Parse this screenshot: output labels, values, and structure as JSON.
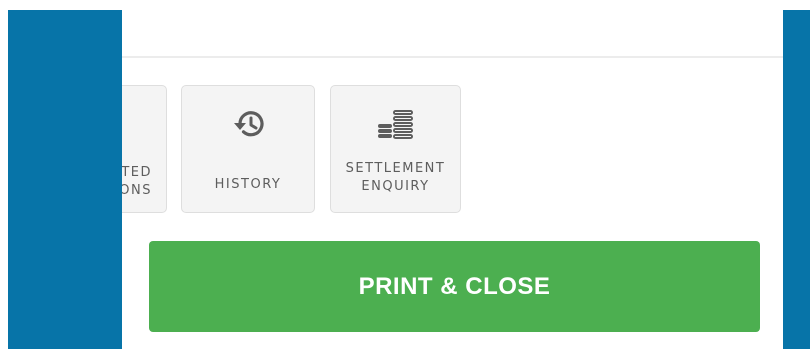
{
  "theme": {
    "sidebar": "#0774a8",
    "tile_bg": "#f4f4f4",
    "primary_button": "#4caf50",
    "tile_text": "#5d5d5d"
  },
  "tiles": [
    {
      "line1": "TED",
      "line2": "IONS",
      "icon": ""
    },
    {
      "label": "HISTORY",
      "icon": "history-icon"
    },
    {
      "line1": "SETTLEMENT",
      "line2": "ENQUIRY",
      "icon": "coins-icon"
    }
  ],
  "actions": {
    "print_close_label": "PRINT & CLOSE"
  }
}
